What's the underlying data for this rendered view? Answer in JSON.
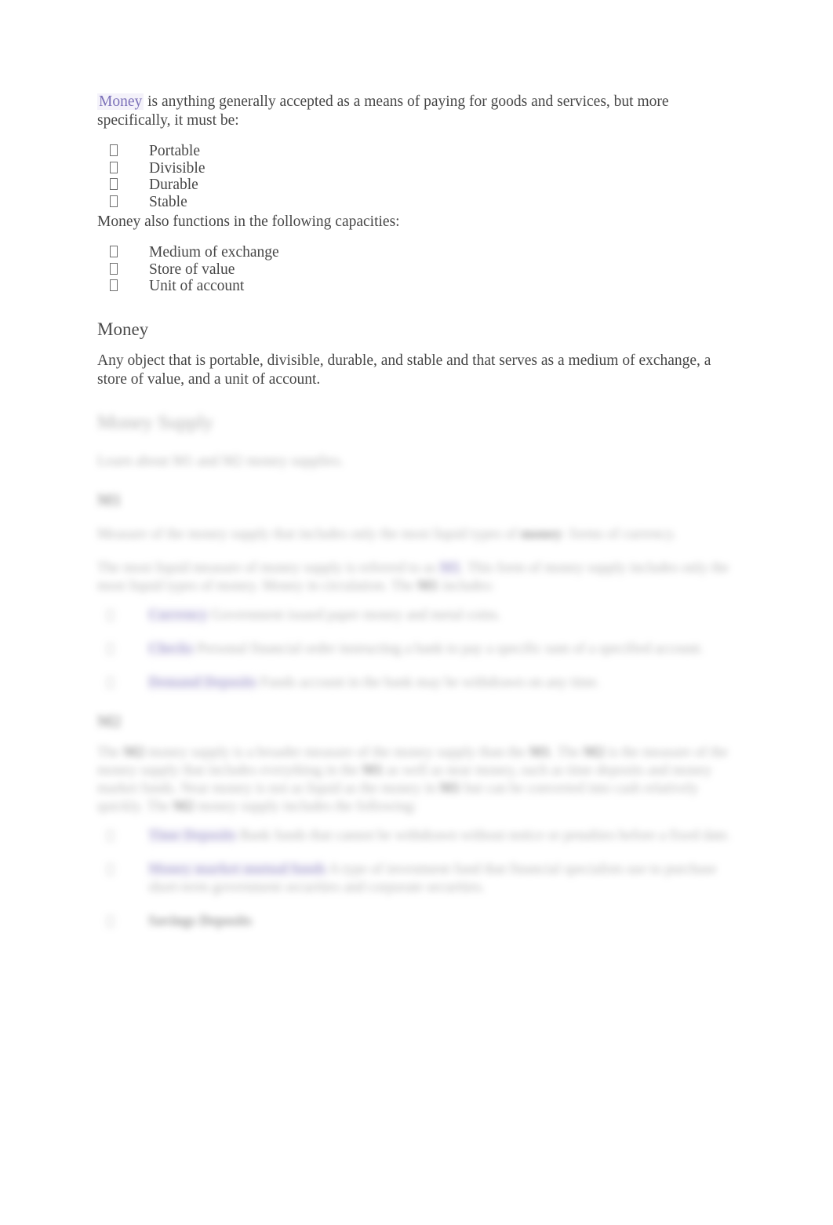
{
  "document": {
    "bullet_glyph": "missing-glyph-box",
    "link_color": "#7b70b8",
    "link_highlight": "#f4f2fa",
    "body_color": "#474747"
  },
  "intro": {
    "term": "Money",
    "text": " is anything generally accepted as a means of paying for goods and services, but more specifically, it must be:"
  },
  "properties": [
    {
      "label": "Portable"
    },
    {
      "label": "Divisible"
    },
    {
      "label": "Durable"
    },
    {
      "label": "Stable"
    }
  ],
  "functions_lead": "Money also functions in the following capacities:",
  "functions": [
    {
      "label": "Medium of exchange"
    },
    {
      "label": "Store of value"
    },
    {
      "label": "Unit of account"
    }
  ],
  "definition": {
    "heading": "Money",
    "body": "Any object that is portable, divisible, durable, and stable and that serves as a medium of exchange, a store of value, and a unit of account."
  },
  "money_supply": {
    "heading": "Money Supply",
    "subtitle": "Learn about M1 and M2 money supplies.",
    "m1": {
      "heading": "M1",
      "intro_a": "Measure of the money supply that includes only the most liquid types of ",
      "intro_strong": "money",
      "intro_b": ": forms of currency.",
      "detail_a": "The most liquid measure of money supply is referred to as ",
      "detail_link": "M1",
      "detail_b": ". This form of money supply includes only the most liquid types of money. Money in circulation. The ",
      "detail_strong": "M1",
      "detail_c": " includes:",
      "items": [
        {
          "term": "Currency",
          "text": " Government issued paper money and metal coins."
        },
        {
          "term": "Checks",
          "text": " Personal financial order instructing a bank to pay a specific sum of a specified account."
        },
        {
          "term": "Demand Deposits",
          "text": " Funds account in the bank may be withdrawn on any time."
        }
      ]
    },
    "m2": {
      "heading": "M2",
      "paragraph_a": "The ",
      "paragraph_strong1": "M2",
      "paragraph_b": " money supply is a broader measure of the money supply than the ",
      "paragraph_strong2": "M1",
      "paragraph_c": ". The ",
      "paragraph_strong3": "M2",
      "paragraph_d": " is the measure of the money supply that includes everything in the ",
      "paragraph_strong4": "M1",
      "paragraph_e": " as well as near money, such as time deposits and money market funds. Near money is not as liquid as the money in ",
      "paragraph_strong5": "M1",
      "paragraph_f": " but can be converted into cash relatively quickly. The ",
      "paragraph_strong6": "M2",
      "paragraph_g": " money supply includes the following:",
      "items": [
        {
          "term": "Time Deposits",
          "text": " Bank funds that cannot be withdrawn without notice or penalties before a fixed date."
        },
        {
          "term": "Money market mutual funds",
          "text": " A type of investment fund that financial specialists use to purchase short-term government securities and corporate securities."
        },
        {
          "term": "Savings Deposits",
          "text": ""
        }
      ]
    }
  }
}
